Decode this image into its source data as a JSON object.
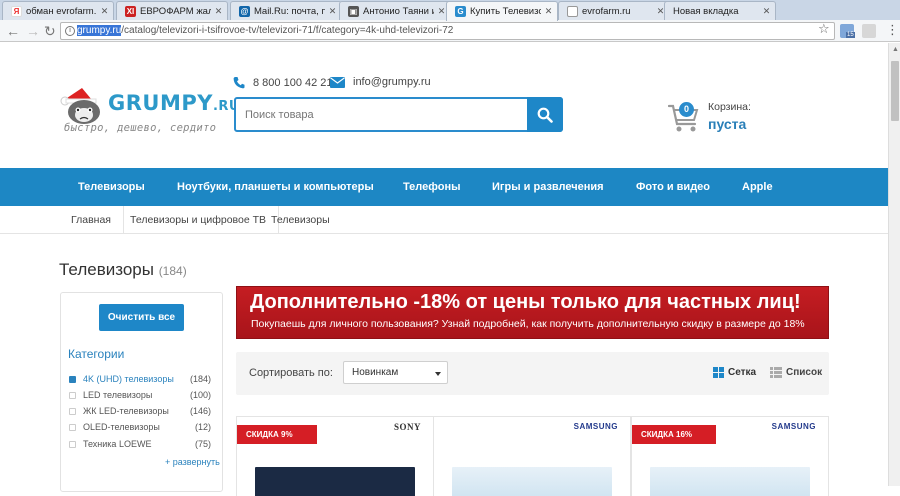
{
  "browser": {
    "tabs": [
      {
        "title": "обман evrofarm.ru",
        "icon": "yandex-icon",
        "color": "#e33"
      },
      {
        "title": "ЕВРОФАРМ жалоб",
        "icon": "otzovik-icon",
        "color": "#c22"
      },
      {
        "title": "Mail.Ru: почта, пои",
        "icon": "mailru-icon",
        "color": "#16a"
      },
      {
        "title": "Антонио Таяни из",
        "icon": "news-icon",
        "color": "#555"
      },
      {
        "title": "Купить Телевизоры",
        "icon": "grumpy-icon",
        "color": "#2a8ccd"
      },
      {
        "title": "evrofarm.ru",
        "icon": "page-icon",
        "color": "#999"
      },
      {
        "title": "Новая вкладка",
        "icon": "",
        "color": ""
      }
    ],
    "url_host": "grumpy.ru",
    "url_path": "/catalog/televizori-i-tsifrovoe-tv/televizori-71/f/category=4k-uhd-televizori-72",
    "ext_badge": "15"
  },
  "header": {
    "logo_main": "GRUMPY",
    "logo_suffix": ".RU",
    "slogan": "быстро, дешево, сердито",
    "phone": "8 800 100 42 21",
    "email": "info@grumpy.ru",
    "search_placeholder": "Поиск товара",
    "cart_label": "Корзина:",
    "cart_value": "пуста",
    "cart_count": "0"
  },
  "nav": [
    "Телевизоры",
    "Ноутбуки, планшеты и компьютеры",
    "Телефоны",
    "Игры и развлечения",
    "Фото и видео",
    "Apple"
  ],
  "breadcrumbs": [
    "Главная",
    "Телевизоры и цифровое ТВ",
    "Телевизоры"
  ],
  "page": {
    "title": "Телевизоры",
    "count": "(184)"
  },
  "sidebar": {
    "clear_label": "Очистить все",
    "categories_title": "Категории",
    "categories": [
      {
        "label": "4K (UHD) телевизоры",
        "count": "(184)",
        "checked": true
      },
      {
        "label": "LED телевизоры",
        "count": "(100)",
        "checked": false
      },
      {
        "label": "ЖК LED-телевизоры",
        "count": "(146)",
        "checked": false
      },
      {
        "label": "OLED-телевизоры",
        "count": "(12)",
        "checked": false
      },
      {
        "label": "Техника LOEWE",
        "count": "(75)",
        "checked": false
      }
    ],
    "expand_label": "+ развернуть"
  },
  "promo": {
    "headline": "Дополнительно -18% от цены только для частных лиц!",
    "sub": "Покупаешь для личного пользования? Узнай подробней, как получить дополнительную скидку в размере до 18%"
  },
  "sort": {
    "label": "Сортировать по:",
    "selected": "Новинкам",
    "view_grid": "Сетка",
    "view_list": "Список"
  },
  "products": [
    {
      "badge": "СКИДКА 9%",
      "brand": "SONY"
    },
    {
      "badge": "",
      "brand": "SAMSUNG"
    },
    {
      "badge": "СКИДКА 16%",
      "brand": "SAMSUNG"
    }
  ],
  "colors": {
    "brand_blue": "#1d87c4",
    "promo_red": "#c51d22",
    "badge_red": "#d51e25"
  }
}
